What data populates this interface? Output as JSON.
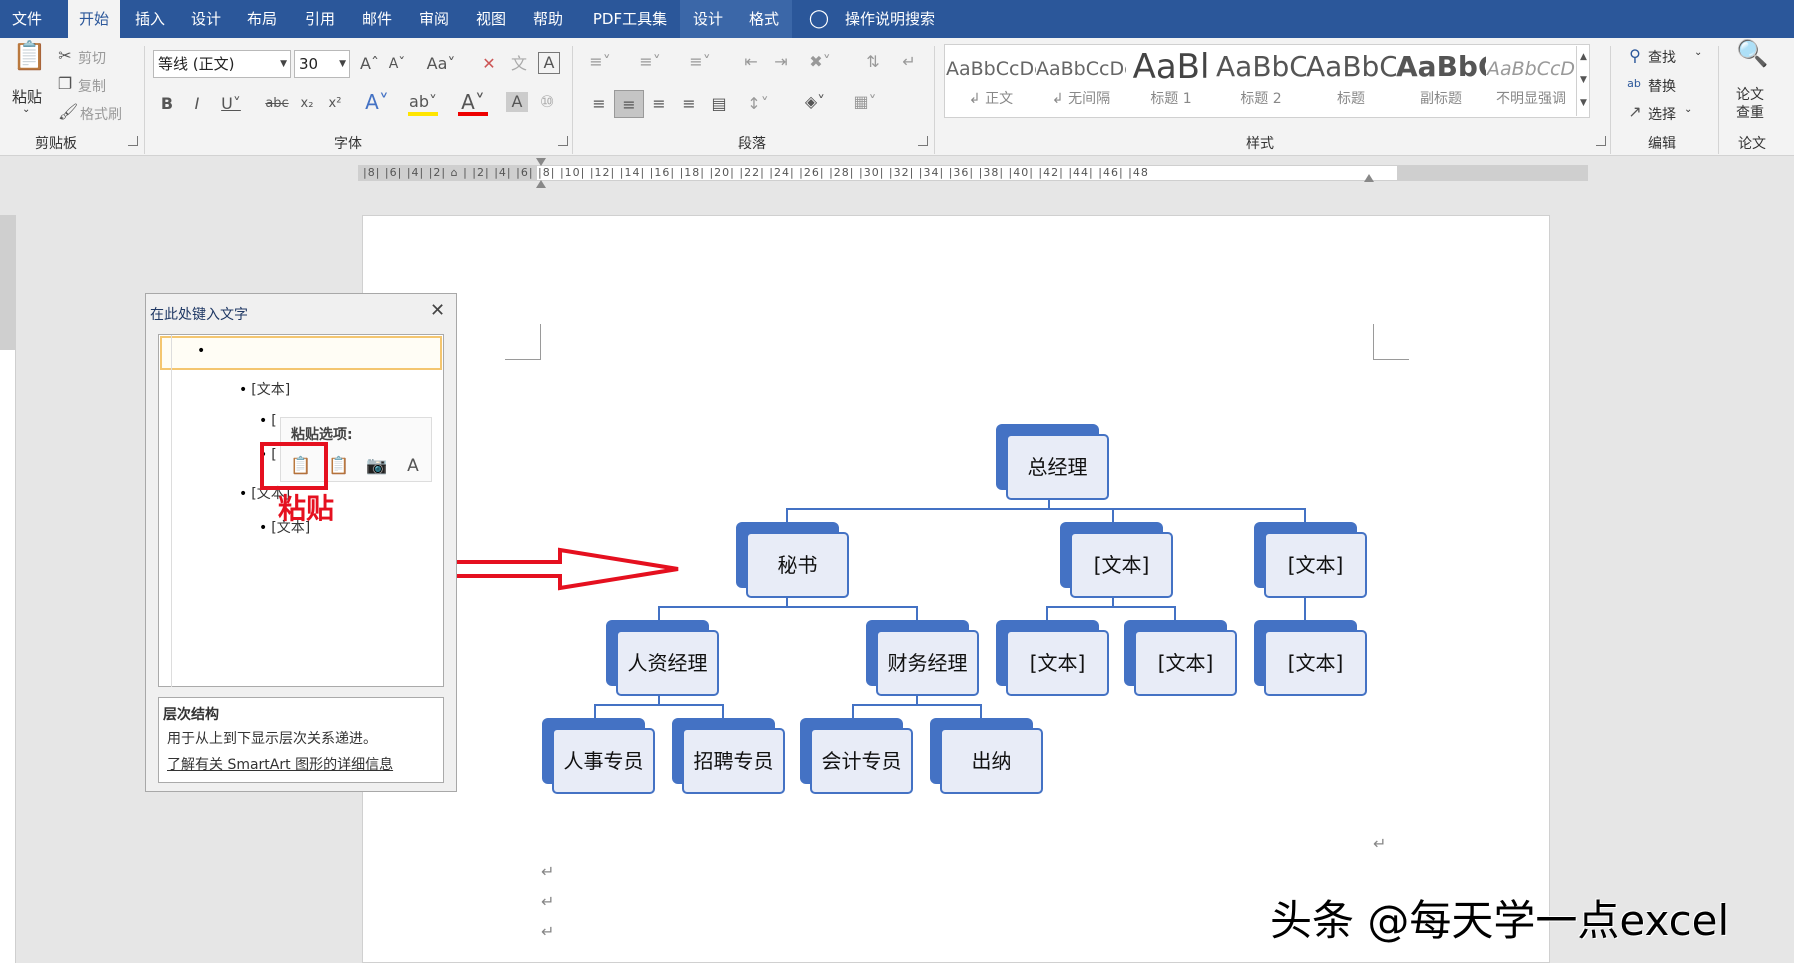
{
  "tabs": [
    "文件",
    "开始",
    "插入",
    "设计",
    "布局",
    "引用",
    "邮件",
    "审阅",
    "视图",
    "帮助",
    "PDF工具集",
    "设计",
    "格式"
  ],
  "tell_me": "操作说明搜索",
  "clipboard": {
    "paste": "粘贴",
    "cut": "剪切",
    "copy": "复制",
    "format_painter": "格式刷",
    "label": "剪贴板"
  },
  "font": {
    "name": "等线 (正文)",
    "size": "30",
    "label": "字体"
  },
  "paragraph": {
    "label": "段落"
  },
  "styles": {
    "label": "样式",
    "items": [
      {
        "sample": "AaBbCcDc",
        "name": "↲ 正文"
      },
      {
        "sample": "AaBbCcDc",
        "name": "↲ 无间隔"
      },
      {
        "sample": "AaBl",
        "name": "标题 1"
      },
      {
        "sample": "AaBbC(",
        "name": "标题 2"
      },
      {
        "sample": "AaBbC(",
        "name": "标题"
      },
      {
        "sample": "AaBbC",
        "name": "副标题"
      },
      {
        "sample": "AaBbCcD",
        "name": "不明显强调"
      }
    ]
  },
  "editing": {
    "find": "查找",
    "replace": "替换",
    "select": "选择",
    "label": "编辑"
  },
  "paper": {
    "check": "论文\n查重",
    "label": "论文"
  },
  "ruler": "|8|  |6|  |4|  |2|  ⌂  |  |2|  |4|  |6|  |8|  |10|  |12|  |14|  |16|  |18|  |20|  |22|  |24|  |26|  |28|  |30|  |32|  |34|  |36|  |38|  |40|  |42|  |44|  |46|  |48",
  "text_pane": {
    "title": "在此处键入文字",
    "bullets": [
      "",
      "[文本]",
      "[",
      "[",
      "[文本]",
      "[文本]"
    ],
    "desc_title": "层次结构",
    "desc_text": "用于从上到下显示层次关系递进。",
    "desc_link": "了解有关 SmartArt 图形的详细信息"
  },
  "paste_options": {
    "title": "粘贴选项:",
    "annotation": "粘贴"
  },
  "org_chart": {
    "top": "总经理",
    "level2": [
      "秘书",
      "[文本]",
      "[文本]"
    ],
    "level3": [
      "人资经理",
      "财务经理",
      "[文本]",
      "[文本]",
      "[文本]"
    ],
    "level4": [
      "人事专员",
      "招聘专员",
      "会计专员",
      "出纳"
    ]
  },
  "watermark": "头条 @每天学一点excel"
}
